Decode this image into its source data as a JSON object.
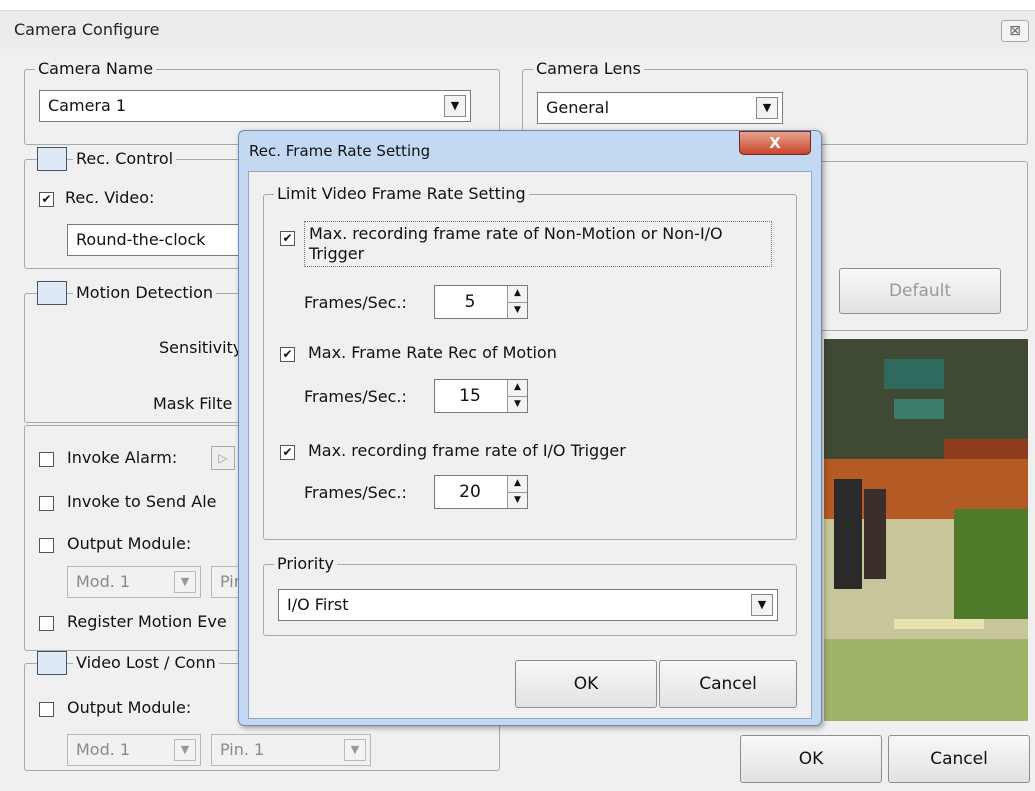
{
  "window": {
    "title": "Camera Configure",
    "close_label": "⊠"
  },
  "camera_name": {
    "legend": "Camera Name",
    "value": "Camera 1"
  },
  "camera_lens": {
    "legend": "Camera Lens",
    "value": "General"
  },
  "rec_control": {
    "legend": "Rec. Control",
    "rec_video_label": "Rec. Video:",
    "schedule_value": "Round-the-clock"
  },
  "motion_detection": {
    "legend": "Motion Detection",
    "sensitivity_label": "Sensitivity",
    "mask_filter_label": "Mask Filte"
  },
  "alarm_group": {
    "invoke_alarm_label": "Invoke Alarm:",
    "invoke_send_label": "Invoke to Send Ale",
    "output_module_label": "Output Module:",
    "mod_value": "Mod. 1",
    "pin_value": "Pin",
    "register_motion_label": "Register Motion Eve"
  },
  "video_lost": {
    "legend": "Video Lost / Conn",
    "output_module_label": "Output Module:",
    "mod_value": "Mod. 1",
    "pin_value": "Pin. 1"
  },
  "right_panel": {
    "default_label": "Default"
  },
  "footer": {
    "ok_label": "OK",
    "cancel_label": "Cancel"
  },
  "dialog": {
    "title": "Rec. Frame Rate Setting",
    "close_label": "X",
    "limit_legend": "Limit Video Frame Rate Setting",
    "opt1_label": "Max. recording frame rate of Non-Motion or Non-I/O Trigger",
    "opt1_fps": "5",
    "opt2_label": "Max. Frame Rate Rec of Motion",
    "opt2_fps": "15",
    "opt3_label": "Max. recording frame rate of I/O Trigger",
    "opt3_fps": "20",
    "fps_label": "Frames/Sec.:",
    "priority_legend": "Priority",
    "priority_value": "I/O First",
    "ok_label": "OK",
    "cancel_label": "Cancel"
  },
  "colors": {
    "dialog_frame": "#c3d9f2",
    "close_red": "#c8452c",
    "checked": "#111111"
  },
  "checks": {
    "rec_video": true,
    "opt1": true,
    "opt2": true,
    "opt3": true
  }
}
